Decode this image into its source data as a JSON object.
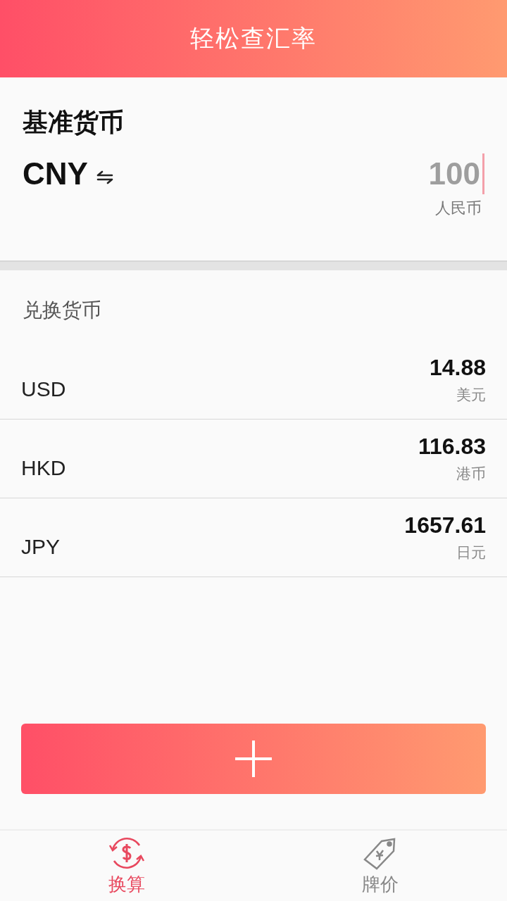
{
  "header": {
    "title": "轻松查汇率"
  },
  "base": {
    "heading": "基准货币",
    "code": "CNY",
    "amount": "100",
    "name": "人民币"
  },
  "exchange": {
    "heading": "兑换货币",
    "rows": [
      {
        "code": "USD",
        "amount": "14.88",
        "name": "美元"
      },
      {
        "code": "HKD",
        "amount": "116.83",
        "name": "港币"
      },
      {
        "code": "JPY",
        "amount": "1657.61",
        "name": "日元"
      }
    ]
  },
  "tabs": [
    {
      "label": "换算",
      "kind": "convert",
      "selected": true
    },
    {
      "label": "牌价",
      "kind": "price",
      "selected": false
    }
  ]
}
